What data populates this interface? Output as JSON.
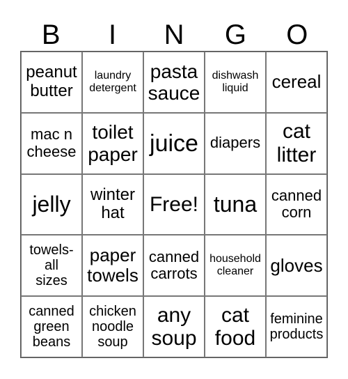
{
  "header": [
    "B",
    "I",
    "N",
    "G",
    "O"
  ],
  "cells": [
    [
      "peanut\nbutter",
      "laundry\ndetergent",
      "pasta\nsauce",
      "dishwash\nliquid",
      "cereal"
    ],
    [
      "mac n\ncheese",
      "toilet\npaper",
      "juice",
      "diapers",
      "cat\nlitter"
    ],
    [
      "jelly",
      "winter\nhat",
      "Free!",
      "tuna",
      "canned\ncorn"
    ],
    [
      "towels-\nall\nsizes",
      "paper\ntowels",
      "canned\ncarrots",
      "household\ncleaner",
      "gloves"
    ],
    [
      "canned\ngreen\nbeans",
      "chicken\nnoodle\nsoup",
      "any\nsoup",
      "cat\nfood",
      "feminine\nproducts"
    ]
  ]
}
